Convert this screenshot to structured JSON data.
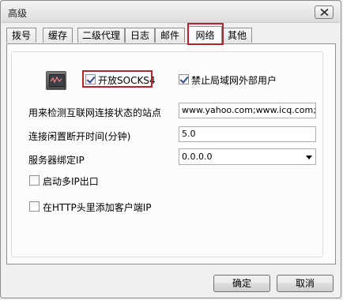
{
  "window": {
    "title": "高级"
  },
  "tabs": [
    {
      "label": "拨号"
    },
    {
      "label": "缓存"
    },
    {
      "label": "二级代理"
    },
    {
      "label": "日志"
    },
    {
      "label": "邮件"
    },
    {
      "label": "网络",
      "active": true
    },
    {
      "label": "其他"
    }
  ],
  "network": {
    "enable_socks4": {
      "label": "开放SOCKS4",
      "checked": true
    },
    "block_lan_external_users": {
      "label": "禁止局域网外部用户",
      "checked": true
    },
    "connectivity_check_sites": {
      "label": "用来检测互联网连接状态的站点",
      "value": "www.yahoo.com;www.icq.com;www"
    },
    "idle_disconnect": {
      "label": "连接闲置断开时间(分钟)",
      "value": "5.0"
    },
    "bind_ip": {
      "label": "服务器绑定IP",
      "value": "0.0.0.0"
    },
    "multi_ip_exit": {
      "label": "启动多IP出口",
      "checked": false
    },
    "add_client_ip_header": {
      "label": "在HTTP头里添加客户端IP",
      "checked": false
    }
  },
  "buttons": {
    "ok": "确定",
    "cancel": "取消"
  },
  "highlight_color": "#b2252a",
  "icons": {
    "close": "close-icon",
    "app": "network-monitor-icon",
    "dropdown": "chevron-down-icon"
  }
}
